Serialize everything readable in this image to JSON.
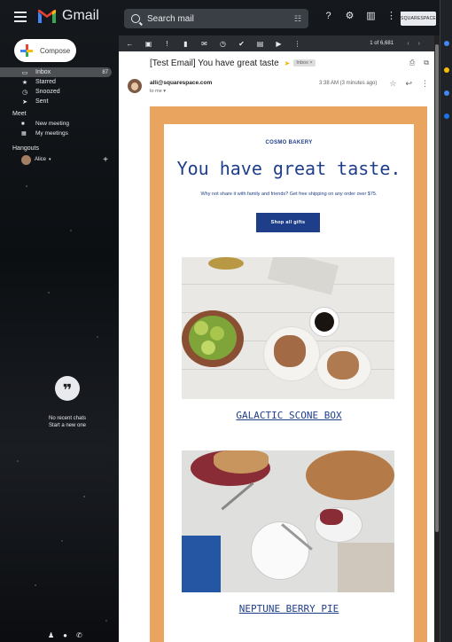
{
  "app": {
    "name": "Gmail",
    "search_placeholder": "Search mail"
  },
  "header": {
    "squarespace_badge": "SQUARESPACE"
  },
  "sidebar": {
    "compose_label": "Compose",
    "items": [
      {
        "label": "Inbox",
        "count": "87",
        "icon": "inbox-icon"
      },
      {
        "label": "Starred",
        "count": "",
        "icon": "star-icon"
      },
      {
        "label": "Snoozed",
        "count": "",
        "icon": "clock-icon"
      },
      {
        "label": "Sent",
        "count": "",
        "icon": "send-icon"
      }
    ],
    "meet_heading": "Meet",
    "meet_items": [
      {
        "label": "New meeting",
        "icon": "video-icon"
      },
      {
        "label": "My meetings",
        "icon": "calendar-icon"
      }
    ],
    "hangouts_heading": "Hangouts",
    "hangouts_user": "Alice",
    "no_chats_line1": "No recent chats",
    "no_chats_line2": "Start a new one"
  },
  "toolbar": {
    "count": "1 of 6,681"
  },
  "message": {
    "subject": "[Test Email] You have great taste",
    "label": "Inbox",
    "sender": "alli@squarespace.com",
    "to": "to me",
    "time": "3:38 AM (3 minutes ago)"
  },
  "email": {
    "brand": "COSMO BAKERY",
    "headline": "You have great taste.",
    "subhead": "Why not share it with family and friends? Get free shipping on any order over $75.",
    "button": "Shop all gifts",
    "product1": "GALACTIC SCONE BOX",
    "product2": "NEPTUNE BERRY PIE"
  },
  "colors": {
    "accent_navy": "#1f3e89",
    "email_border": "#e9a560"
  }
}
